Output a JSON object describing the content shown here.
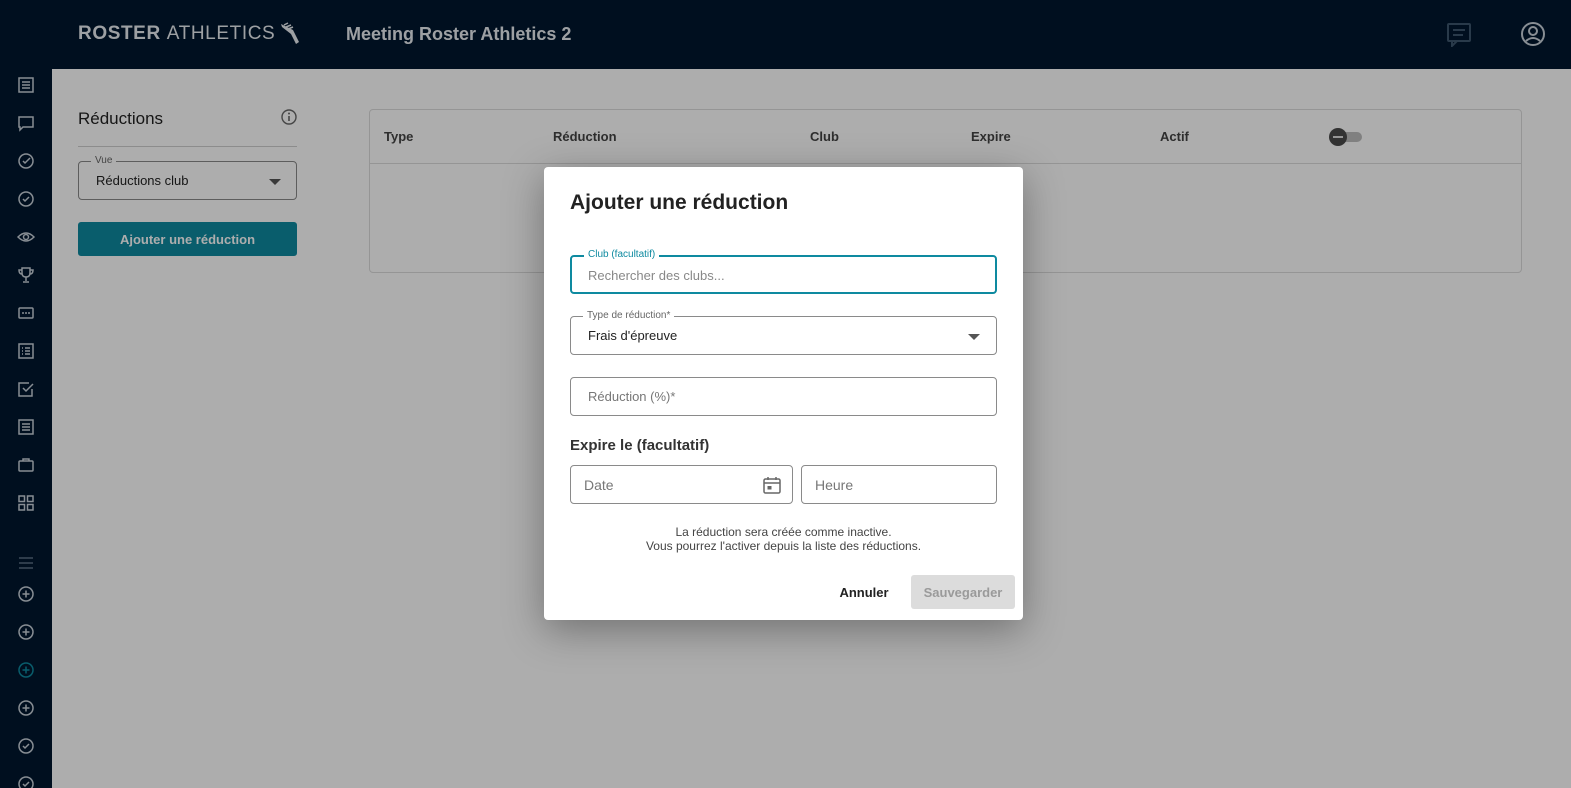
{
  "header": {
    "logo_bold": "ROSTER",
    "logo_light": "ATHLETICS",
    "title": "Meeting Roster Athletics 2",
    "icons": [
      "chat-icon",
      "account-icon"
    ]
  },
  "rail": {
    "icons": [
      "list-icon",
      "message-icon",
      "check-circle-icon",
      "check-circle-icon",
      "eye-icon",
      "trophy-icon",
      "ticket-icon",
      "list-alt-icon",
      "checkbox-icon",
      "list-icon",
      "briefcase-icon",
      "grid-icon",
      "menu-icon",
      "add-circle-icon",
      "add-circle-icon",
      "add-circle-active-icon",
      "add-circle-icon",
      "check-circle-icon",
      "check-circle-icon"
    ],
    "active_color": "#0e8aa0"
  },
  "panel": {
    "title": "Réductions",
    "view_label": "Vue",
    "view_value": "Réductions club",
    "add_button": "Ajouter une réduction"
  },
  "table": {
    "headers": [
      "Type",
      "Réduction",
      "Club",
      "Expire",
      "Actif"
    ]
  },
  "dialog": {
    "title": "Ajouter une réduction",
    "club_label": "Club (facultatif)",
    "club_placeholder": "Rechercher des clubs...",
    "type_label": "Type de réduction*",
    "type_value": "Frais d'épreuve",
    "reduction_placeholder": "Réduction (%)*",
    "expire_label": "Expire le (facultatif)",
    "date_placeholder": "Date",
    "time_placeholder": "Heure",
    "note_line1": "La réduction sera créée comme inactive.",
    "note_line2": "Vous pourrez l'activer depuis la liste des réductions.",
    "cancel": "Annuler",
    "save": "Sauvegarder"
  },
  "colors": {
    "navy": "#00172e",
    "accent": "#0e8aa0"
  }
}
